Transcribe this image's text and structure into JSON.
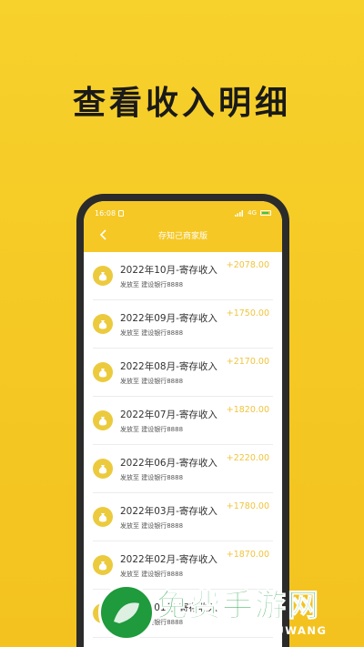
{
  "promo": {
    "title": "查看收入明细"
  },
  "status_bar": {
    "time": "16:08",
    "signal": "4G",
    "colors": {
      "battery": "#3ec44d"
    }
  },
  "header": {
    "title": "存知己商家版",
    "background": "#f5c826"
  },
  "rows": [
    {
      "title": "2022年10月-寄存收入",
      "subtitle": "发放至 建设银行8888",
      "amount": "+2078.00"
    },
    {
      "title": "2022年09月-寄存收入",
      "subtitle": "发放至 建设银行8888",
      "amount": "+1750.00"
    },
    {
      "title": "2022年08月-寄存收入",
      "subtitle": "发放至 建设银行8888",
      "amount": "+2170.00"
    },
    {
      "title": "2022年07月-寄存收入",
      "subtitle": "发放至 建设银行8888",
      "amount": "+1820.00"
    },
    {
      "title": "2022年06月-寄存收入",
      "subtitle": "发放至 建设银行8888",
      "amount": "+2220.00"
    },
    {
      "title": "2022年03月-寄存收入",
      "subtitle": "发放至 建设银行8888",
      "amount": "+1780.00"
    },
    {
      "title": "2022年02月-寄存收入",
      "subtitle": "发放至 建设银行8888",
      "amount": "+1870.00"
    },
    {
      "title": "2022年01月-寄存收入",
      "subtitle": "发放至 建设银行8888",
      "amount": ""
    }
  ],
  "watermark": {
    "text": "免费手游网",
    "sub": "MIANFEISHOUYOUWANG"
  },
  "colors": {
    "background": "#f5c823",
    "amount": "#f0c43c",
    "coin": "#ecca3d",
    "watermark": "#22a244"
  }
}
